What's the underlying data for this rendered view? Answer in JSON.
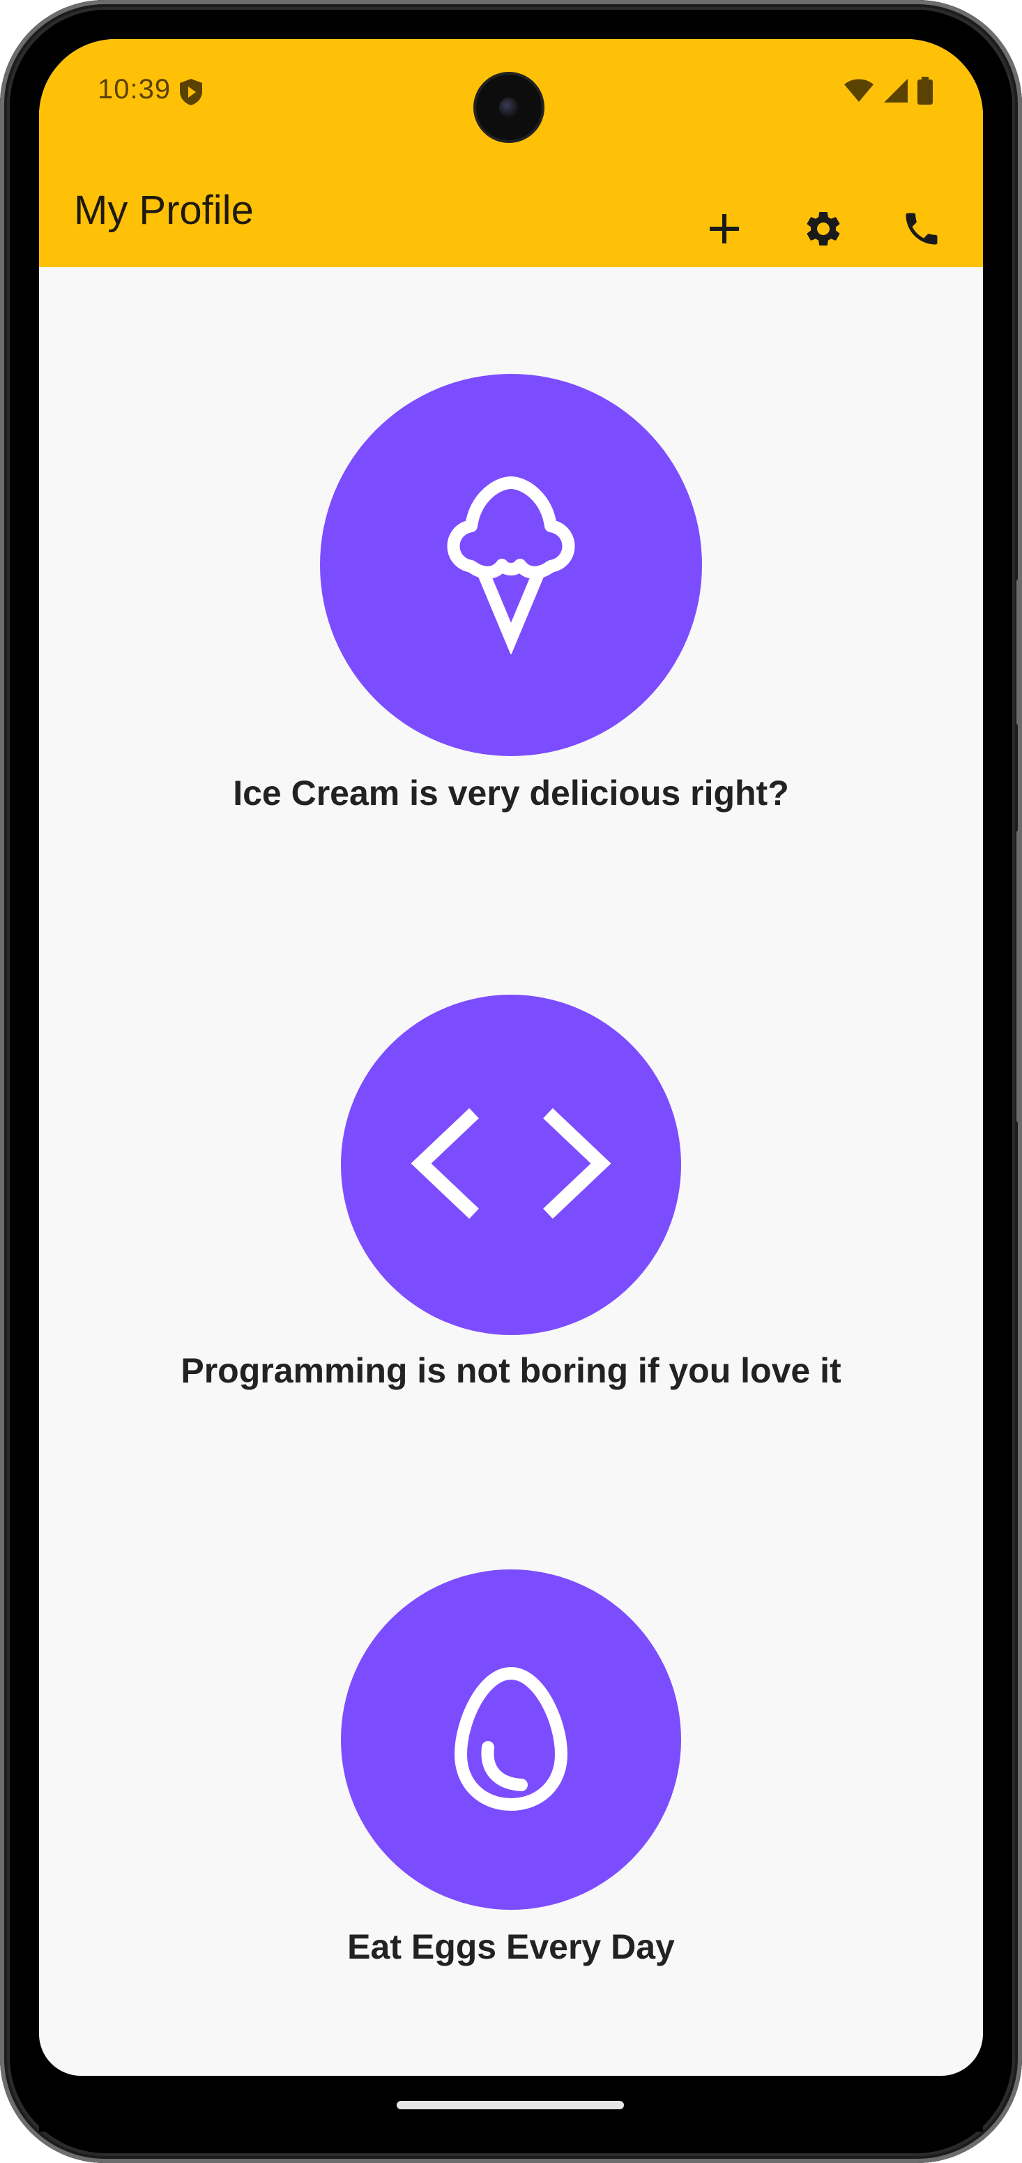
{
  "status_bar": {
    "time": "10:39",
    "icons": [
      "shield-play-icon",
      "wifi-icon",
      "signal-icon",
      "battery-icon"
    ]
  },
  "app_bar": {
    "title": "My Profile",
    "background_color": "#ffc107",
    "actions": [
      {
        "name": "add-button",
        "icon": "plus-icon"
      },
      {
        "name": "settings-button",
        "icon": "gear-icon"
      },
      {
        "name": "call-button",
        "icon": "phone-icon"
      }
    ]
  },
  "items": [
    {
      "icon": "ice-cream-icon",
      "label": "Ice Cream is very delicious right?"
    },
    {
      "icon": "code-icon",
      "label": "Programming is not boring if you love it"
    },
    {
      "icon": "egg-icon",
      "label": "Eat Eggs Every Day"
    }
  ],
  "colors": {
    "accent": "#7c4dff",
    "background": "#f8f8f8",
    "text": "#222222"
  }
}
